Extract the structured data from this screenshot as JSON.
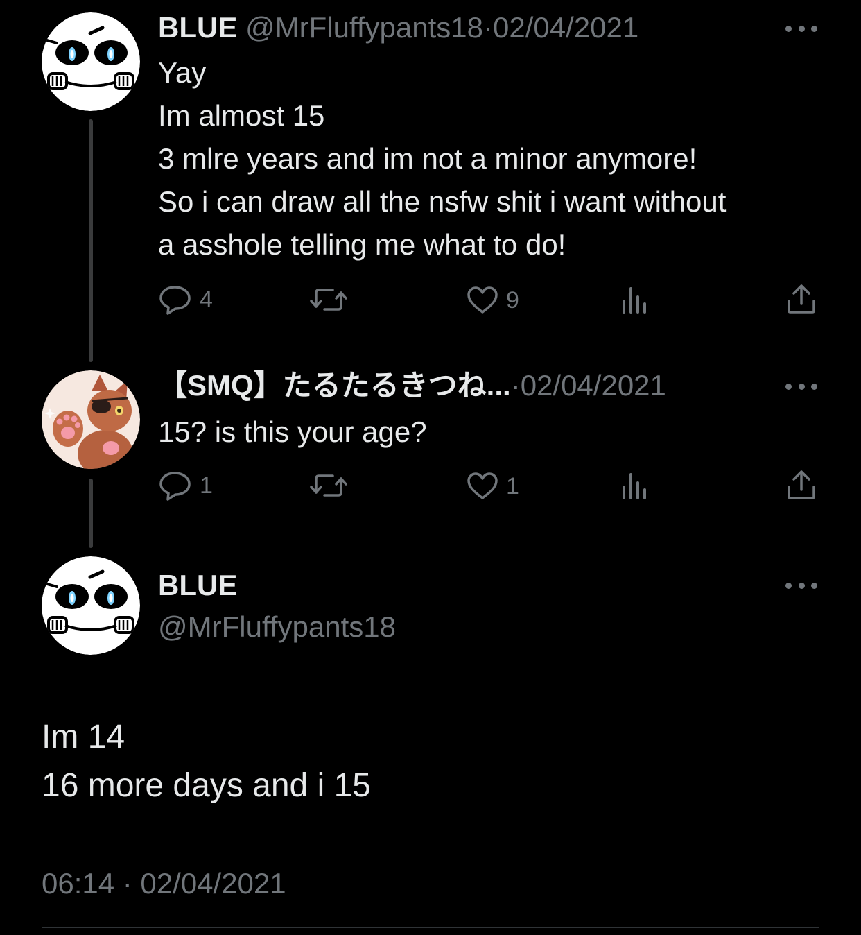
{
  "tweet1": {
    "name": "BLUE",
    "handle": "@MrFluffypants18",
    "separator": "·",
    "date": "02/04/2021",
    "lines": [
      "Yay",
      "Im almost 15",
      "3 mlre years and im not a minor anymore!",
      "So i can draw all the nsfw shit i want without",
      "a asshole telling me what to do!"
    ],
    "actions": {
      "replies": "4",
      "retweets": "",
      "likes": "9"
    }
  },
  "tweet2": {
    "name": "【SMQ】たるたるきつね...",
    "separator": "·",
    "date": "02/04/2021",
    "lines": [
      "15? is this your age?"
    ],
    "actions": {
      "replies": "1",
      "retweets": "",
      "likes": "1"
    }
  },
  "tweet3": {
    "name": "BLUE",
    "handle": "@MrFluffypants18",
    "lines": [
      "Im 14",
      "16 more days and i 15"
    ],
    "timestamp": "06:14 · 02/04/2021"
  },
  "icons": {
    "reply": "speech-bubble-icon",
    "retweet": "retweet-icon",
    "like": "heart-icon",
    "views": "bar-chart-icon",
    "share": "share-icon",
    "more": "more-dots-icon"
  },
  "colors": {
    "background": "#000000",
    "text": "#e7e9ea",
    "muted": "#71767b",
    "thread_line": "#3a3b3c"
  }
}
